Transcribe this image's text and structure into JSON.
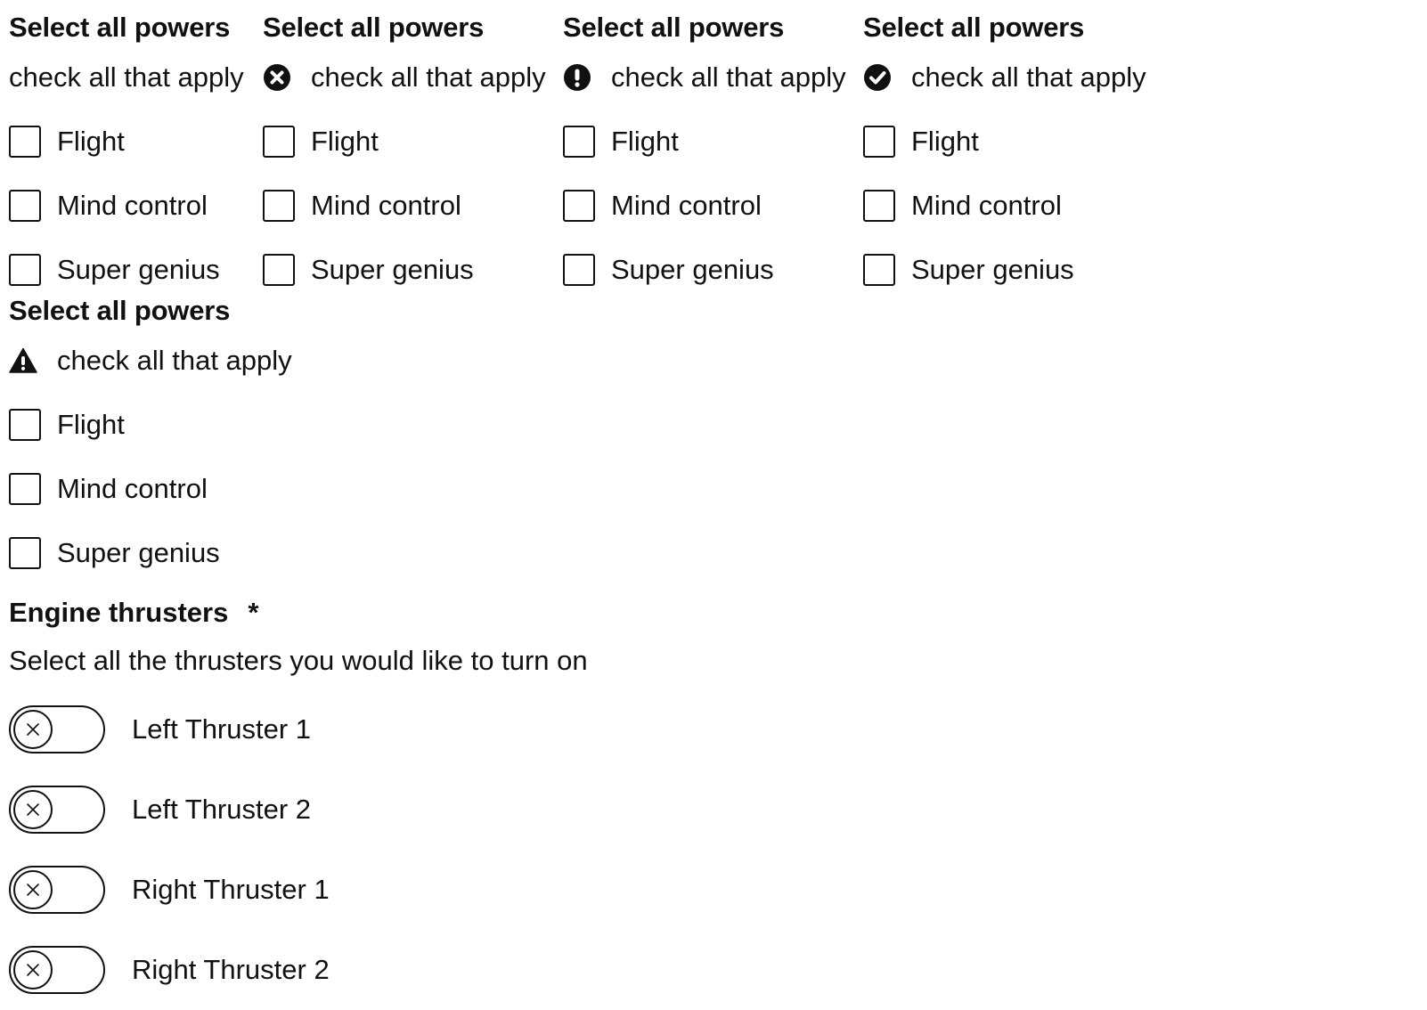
{
  "power_groups": [
    {
      "title": "Select all powers",
      "hint": "check all that apply",
      "status_icon": null,
      "options": [
        "Flight",
        "Mind control",
        "Super genius"
      ]
    },
    {
      "title": "Select all powers",
      "hint": "check all that apply",
      "status_icon": "error-circle-icon",
      "options": [
        "Flight",
        "Mind control",
        "Super genius"
      ]
    },
    {
      "title": "Select all powers",
      "hint": "check all that apply",
      "status_icon": "exclamation-circle-icon",
      "options": [
        "Flight",
        "Mind control",
        "Super genius"
      ]
    },
    {
      "title": "Select all powers",
      "hint": "check all that apply",
      "status_icon": "check-circle-icon",
      "options": [
        "Flight",
        "Mind control",
        "Super genius"
      ]
    },
    {
      "title": "Select all powers",
      "hint": "check all that apply",
      "status_icon": "warning-triangle-icon",
      "options": [
        "Flight",
        "Mind control",
        "Super genius"
      ]
    }
  ],
  "thrusters": {
    "title": "Engine thrusters",
    "required_mark": "*",
    "description": "Select all the thrusters you would like to turn on",
    "items": [
      {
        "label": "Left Thruster 1",
        "on": false
      },
      {
        "label": "Left Thruster 2",
        "on": false
      },
      {
        "label": "Right Thruster 1",
        "on": false
      },
      {
        "label": "Right Thruster 2",
        "on": false
      }
    ]
  },
  "colors": {
    "text": "#111111",
    "background": "#ffffff"
  }
}
